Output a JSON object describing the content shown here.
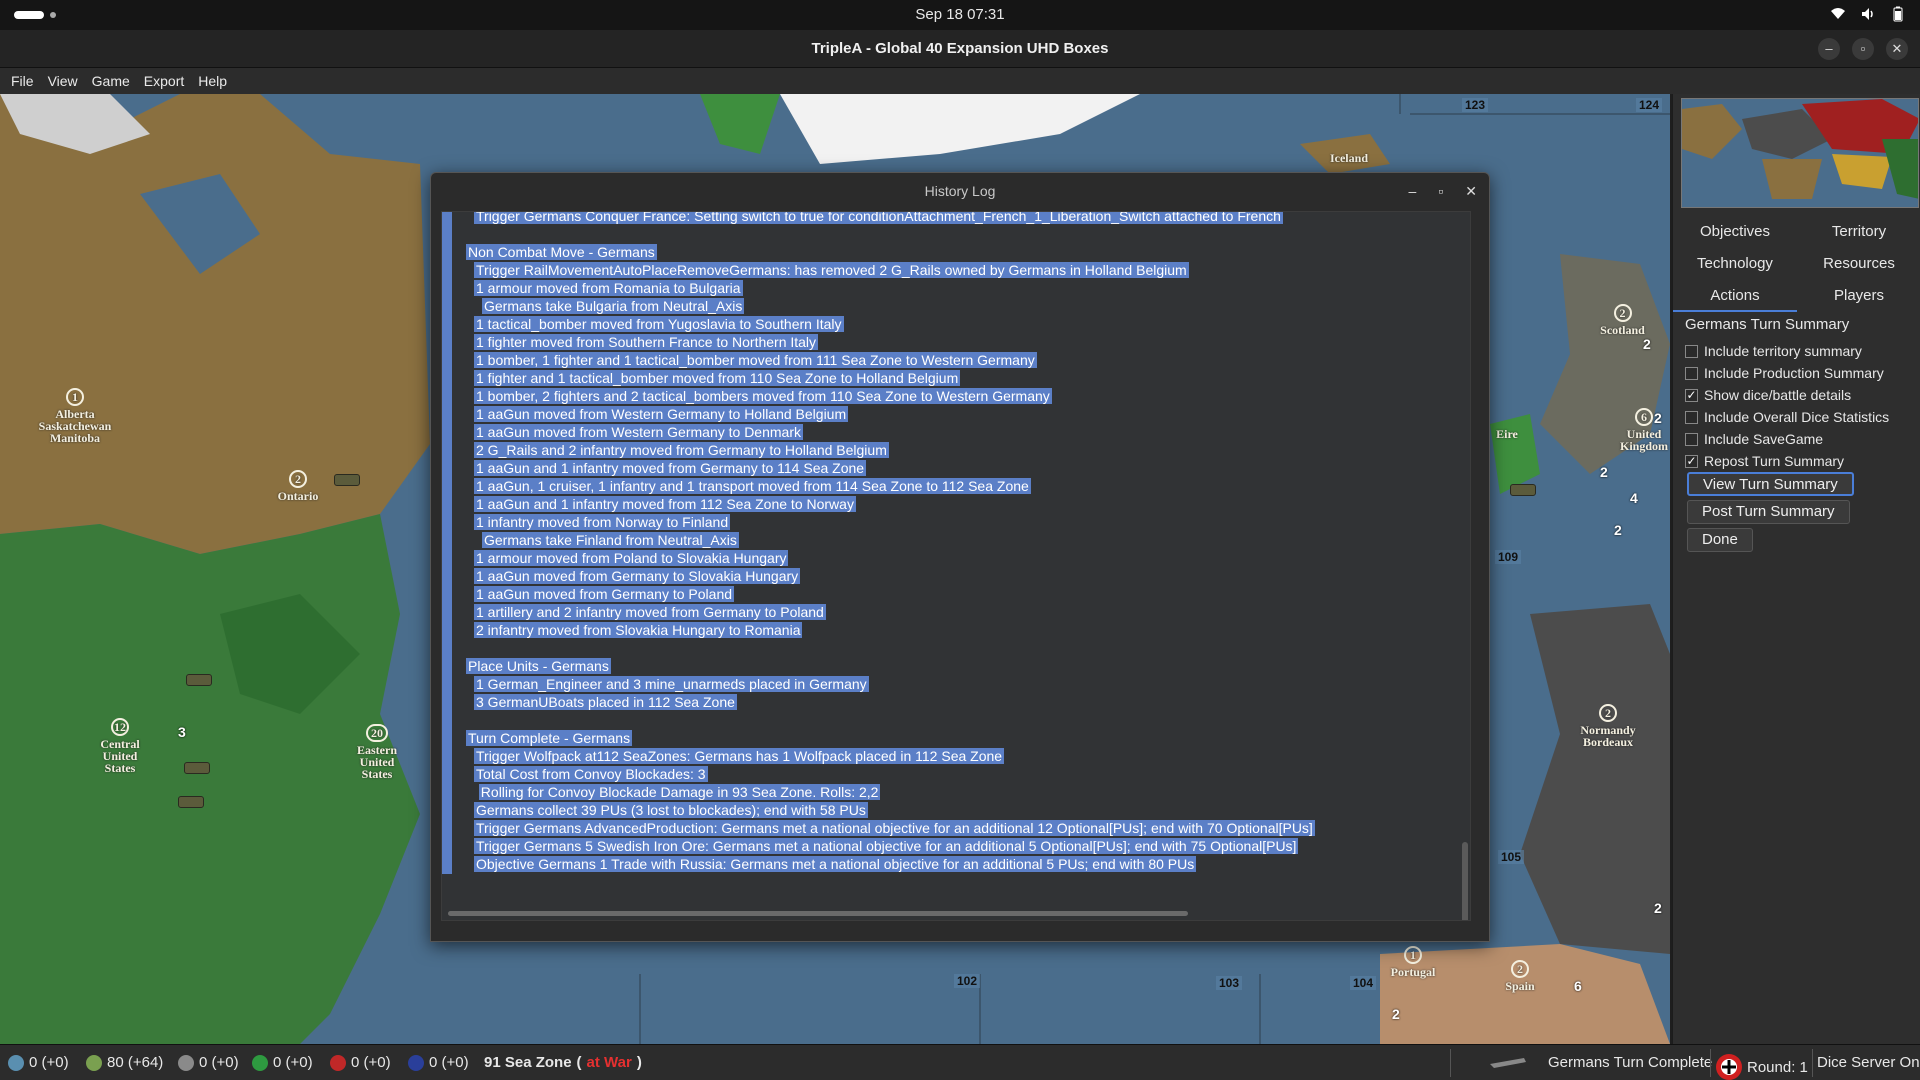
{
  "topbar": {
    "clock": "Sep 18  07:31",
    "wifi_icon": "wifi-icon",
    "volume_icon": "volume-icon",
    "battery_icon": "battery-icon"
  },
  "window": {
    "title": "TripleA - Global 40 Expansion UHD Boxes",
    "minimize": "–",
    "maximize": "▫",
    "close": "✕"
  },
  "menu": {
    "file": "File",
    "view": "View",
    "game": "Game",
    "export": "Export",
    "help": "Help"
  },
  "map": {
    "territories": [
      {
        "name": "Alberta Saskatchewan Manitoba",
        "ipc": "1"
      },
      {
        "name": "Ontario",
        "ipc": "2"
      },
      {
        "name": "Central United States",
        "ipc": "12"
      },
      {
        "name": "Eastern United States",
        "ipc": "20"
      },
      {
        "name": "Scotland",
        "ipc": "2"
      },
      {
        "name": "United Kingdom",
        "ipc": "6"
      },
      {
        "name": "Normandy Bordeaux",
        "ipc": "2"
      },
      {
        "name": "Portugal",
        "ipc": "1"
      },
      {
        "name": "Spain",
        "ipc": "2"
      },
      {
        "name": "Iceland",
        "ipc": ""
      },
      {
        "name": "Eire",
        "ipc": ""
      }
    ],
    "sea_zones": [
      "123",
      "124",
      "109",
      "105",
      "102",
      "103",
      "104"
    ],
    "unit_counts": [
      "3",
      "2",
      "2",
      "4",
      "2",
      "2",
      "2",
      "6",
      "2"
    ]
  },
  "history_log": {
    "title": "History Log",
    "lines": [
      "Trigger Germans Conquer France: Setting switch to true for conditionAttachment_French_1_Liberation_Switch attached to French",
      "",
      "Non Combat Move - Germans",
      "Trigger RailMovementAutoPlaceRemoveGermans: has removed 2 G_Rails owned by Germans in Holland Belgium",
      "1 armour moved from Romania to Bulgaria",
      "Germans take Bulgaria from Neutral_Axis",
      "1 tactical_bomber moved from Yugoslavia to Southern Italy",
      "1 fighter moved from Southern France to Northern Italy",
      "1 bomber, 1 fighter and 1 tactical_bomber moved from 111 Sea Zone to Western Germany",
      "1 fighter and 1 tactical_bomber moved from 110 Sea Zone to Holland Belgium",
      "1 bomber, 2 fighters and 2 tactical_bombers moved from 110 Sea Zone to Western Germany",
      "1 aaGun moved from Western Germany to Holland Belgium",
      "1 aaGun moved from Western Germany to Denmark",
      "2 G_Rails and 2 infantry moved from Germany to Holland Belgium",
      "1 aaGun and 1 infantry moved from Germany to 114 Sea Zone",
      "1 aaGun, 1 cruiser, 1 infantry and 1 transport moved from 114 Sea Zone to 112 Sea Zone",
      "1 aaGun and 1 infantry moved from 112 Sea Zone to Norway",
      "1 infantry moved from Norway to Finland",
      "Germans take Finland from Neutral_Axis",
      "1 armour moved from Poland to Slovakia Hungary",
      "1 aaGun moved from Germany to Slovakia Hungary",
      "1 aaGun moved from Germany to Poland",
      "1 artillery and 2 infantry moved from Germany to Poland",
      "2 infantry moved from Slovakia Hungary to Romania",
      "",
      "Place Units - Germans",
      "1 German_Engineer and 3 mine_unarmeds placed in Germany",
      "3 GermanUBoats placed in 112 Sea Zone",
      "",
      "Turn Complete - Germans",
      "Trigger Wolfpack at112 SeaZones: Germans has 1 Wolfpack placed in 112 Sea Zone",
      "Total Cost from Convoy Blockades: 3",
      "Rolling for Convoy Blockade Damage in 93 Sea Zone. Rolls: 2,2",
      "Germans collect 39 PUs (3 lost to blockades); end with 58 PUs",
      "Trigger Germans AdvancedProduction: Germans met a national objective for an additional 12 Optional[PUs]; end with 70 Optional[PUs]",
      "Trigger Germans 5 Swedish Iron Ore: Germans met a national objective for an additional 5 Optional[PUs]; end with 75 Optional[PUs]",
      "Objective Germans 1 Trade with Russia: Germans met a national objective for an additional 5 PUs; end with 80 PUs"
    ],
    "indents": [
      3,
      0,
      2,
      3,
      3,
      4,
      3,
      3,
      3,
      3,
      3,
      3,
      3,
      3,
      3,
      3,
      3,
      3,
      4,
      3,
      3,
      3,
      3,
      3,
      0,
      2,
      3,
      3,
      0,
      2,
      3,
      3,
      3.6,
      3,
      3,
      3,
      3
    ]
  },
  "right_panel": {
    "tabs_row1": [
      "Objectives",
      "Territory"
    ],
    "tabs_row2": [
      "Technology",
      "Resources"
    ],
    "tabs_row3": [
      "Actions",
      "Players"
    ],
    "active_tab": "Actions",
    "summary_title": "Germans Turn Summary",
    "checkboxes": [
      {
        "label": "Include territory summary",
        "checked": false
      },
      {
        "label": "Include Production Summary",
        "checked": false
      },
      {
        "label": "Show dice/battle details",
        "checked": true
      },
      {
        "label": "Include Overall Dice Statistics",
        "checked": false
      },
      {
        "label": "Include SaveGame",
        "checked": false
      },
      {
        "label": "Repost Turn Summary",
        "checked": true
      }
    ],
    "view_button": "View Turn Summary",
    "post_button": "Post Turn Summary",
    "done_button": "Done"
  },
  "statusbar": {
    "r1": "0 (+0)",
    "pus": "80 (+64)",
    "r3": "0 (+0)",
    "r4": "0 (+0)",
    "r5": "0 (+0)",
    "r6": "0 (+0)",
    "territory": "91 Sea Zone",
    "war_open": "(",
    "war_status": "at War",
    "war_close": ")",
    "phase": "Germans Turn Complete",
    "round": "Round: 1",
    "dice": "Dice Server On"
  },
  "colors": {
    "selection": "#5b7fc7",
    "at_war": "#e53030",
    "accent": "#4a7ed8"
  }
}
